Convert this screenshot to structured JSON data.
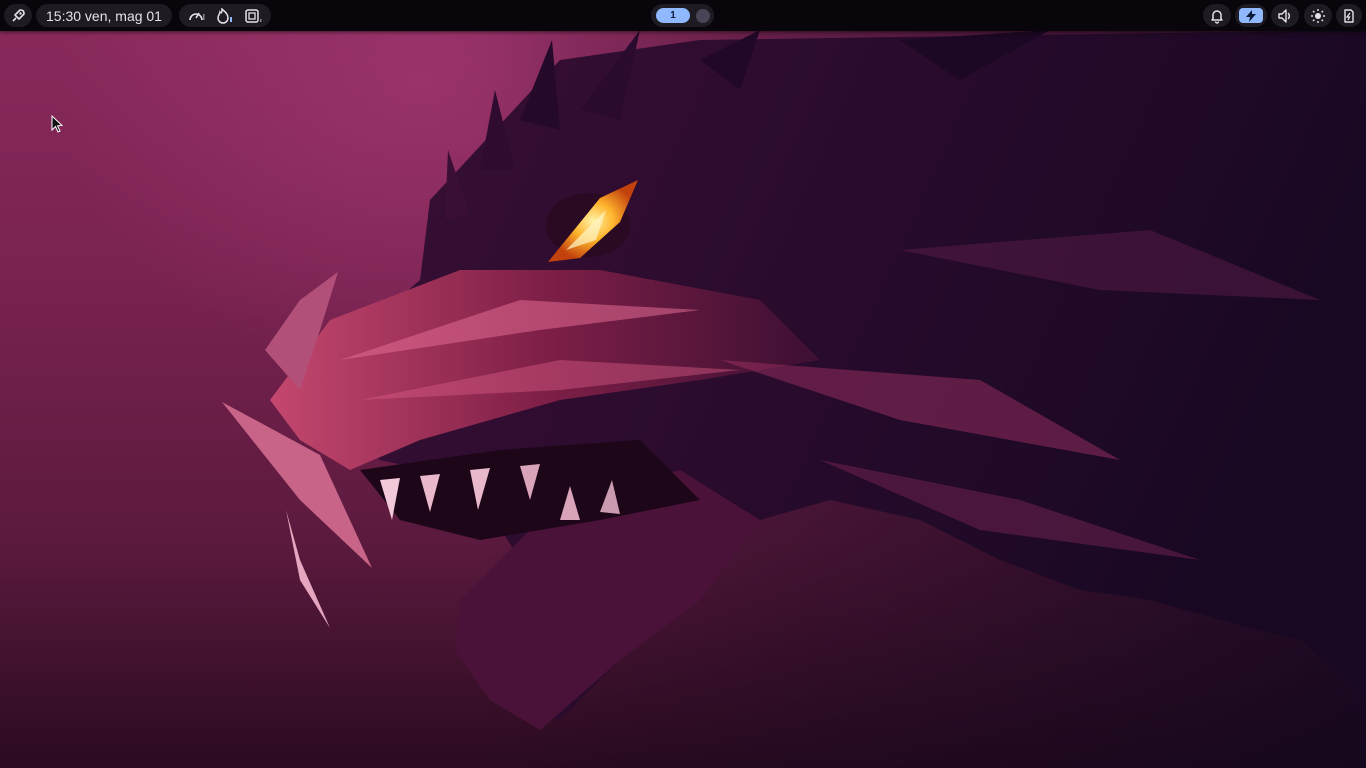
{
  "topbar": {
    "clock": "15:30 ven, mag 01",
    "workspace": {
      "active_label": "1"
    },
    "left_icons": [
      "rocket-icon"
    ],
    "stats_icons": [
      "gauge-icon",
      "flame-icon",
      "cpu-icon"
    ],
    "right_icons": [
      "bell-icon",
      "battery-charging-icon",
      "speaker-icon",
      "brightness-icon",
      "power-icon"
    ]
  },
  "colors": {
    "bar": "#08060a",
    "pill": "#1e1c22",
    "accent": "#8fb8ff",
    "wallpaper_primary": "#7a2351",
    "dragon_eye": "#ffb52e"
  }
}
